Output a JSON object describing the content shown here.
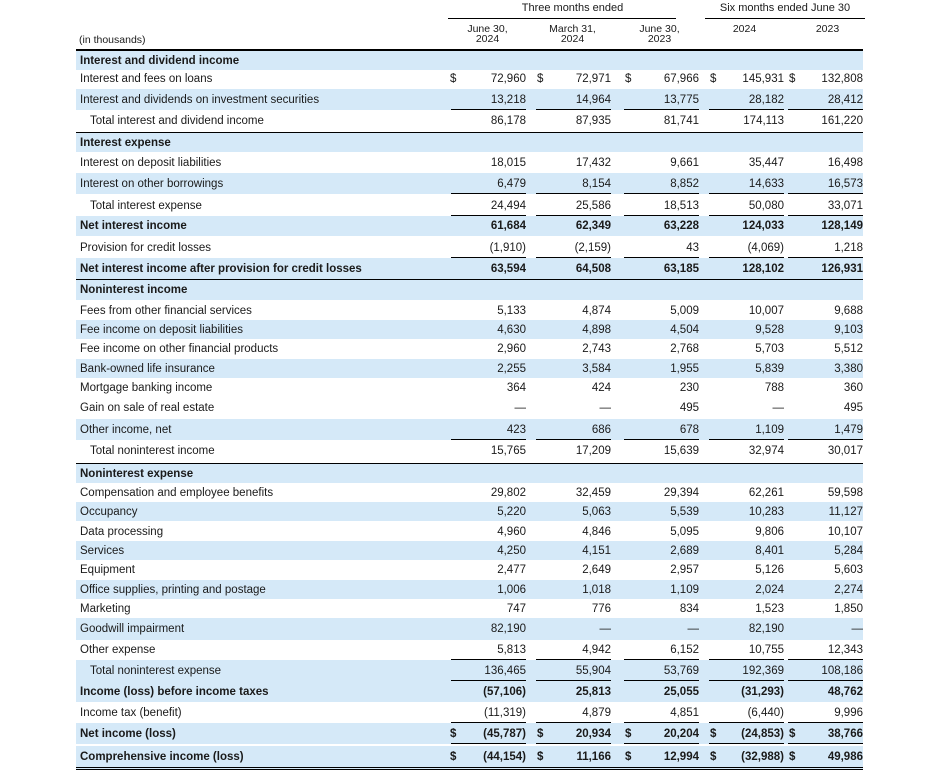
{
  "header": {
    "group_three": "Three months ended",
    "group_six": "Six months ended June 30",
    "units": "(in thousands)",
    "columns": [
      {
        "line1": "June 30,",
        "line2": "2024"
      },
      {
        "line1": "March 31,",
        "line2": "2024"
      },
      {
        "line1": "June 30,",
        "line2": "2023"
      },
      {
        "line1": "",
        "line2": "2024"
      },
      {
        "line1": "",
        "line2": "2023"
      }
    ]
  },
  "rows": [
    {
      "label": "Interest and dividend income",
      "style": "section"
    },
    {
      "label": "Interest and fees on loans",
      "values": [
        "72,960",
        "72,971",
        "67,966",
        "145,931",
        "132,808"
      ],
      "currency": true
    },
    {
      "label": "Interest and dividends on investment securities",
      "values": [
        "13,218",
        "14,964",
        "13,775",
        "28,182",
        "28,412"
      ]
    },
    {
      "label": "Total interest and dividend income",
      "values": [
        "86,178",
        "87,935",
        "81,741",
        "174,113",
        "161,220"
      ],
      "style": "total"
    },
    {
      "label": "Interest expense",
      "style": "section"
    },
    {
      "label": "Interest on deposit liabilities",
      "values": [
        "18,015",
        "17,432",
        "9,661",
        "35,447",
        "16,498"
      ]
    },
    {
      "label": "Interest on other borrowings",
      "values": [
        "6,479",
        "8,154",
        "8,852",
        "14,633",
        "16,573"
      ]
    },
    {
      "label": "Total interest expense",
      "values": [
        "24,494",
        "25,586",
        "18,513",
        "50,080",
        "33,071"
      ],
      "style": "total"
    },
    {
      "label": "Net interest income",
      "values": [
        "61,684",
        "62,349",
        "63,228",
        "124,033",
        "128,149"
      ],
      "style": "bold"
    },
    {
      "label": "Provision for credit losses",
      "values": [
        "(1,910)",
        "(2,159)",
        "43",
        "(4,069)",
        "1,218"
      ]
    },
    {
      "label": "Net interest income after provision for credit losses",
      "values": [
        "63,594",
        "64,508",
        "63,185",
        "128,102",
        "126,931"
      ],
      "style": "bold"
    },
    {
      "label": "Noninterest income",
      "style": "section"
    },
    {
      "label": "Fees from other financial services",
      "values": [
        "5,133",
        "4,874",
        "5,009",
        "10,007",
        "9,688"
      ]
    },
    {
      "label": "Fee income on deposit liabilities",
      "values": [
        "4,630",
        "4,898",
        "4,504",
        "9,528",
        "9,103"
      ]
    },
    {
      "label": "Fee income on other financial products",
      "values": [
        "2,960",
        "2,743",
        "2,768",
        "5,703",
        "5,512"
      ]
    },
    {
      "label": "Bank-owned life insurance",
      "values": [
        "2,255",
        "3,584",
        "1,955",
        "5,839",
        "3,380"
      ]
    },
    {
      "label": "Mortgage banking income",
      "values": [
        "364",
        "424",
        "230",
        "788",
        "360"
      ]
    },
    {
      "label": "Gain on sale of real estate",
      "values": [
        "—",
        "—",
        "495",
        "—",
        "495"
      ]
    },
    {
      "label": "Other income, net",
      "values": [
        "423",
        "686",
        "678",
        "1,109",
        "1,479"
      ]
    },
    {
      "label": "Total noninterest income",
      "values": [
        "15,765",
        "17,209",
        "15,639",
        "32,974",
        "30,017"
      ],
      "style": "total"
    },
    {
      "label": "Noninterest expense",
      "style": "section"
    },
    {
      "label": "Compensation and employee benefits",
      "values": [
        "29,802",
        "32,459",
        "29,394",
        "62,261",
        "59,598"
      ]
    },
    {
      "label": "Occupancy",
      "values": [
        "5,220",
        "5,063",
        "5,539",
        "10,283",
        "11,127"
      ]
    },
    {
      "label": "Data processing",
      "values": [
        "4,960",
        "4,846",
        "5,095",
        "9,806",
        "10,107"
      ]
    },
    {
      "label": "Services",
      "values": [
        "4,250",
        "4,151",
        "2,689",
        "8,401",
        "5,284"
      ]
    },
    {
      "label": "Equipment",
      "values": [
        "2,477",
        "2,649",
        "2,957",
        "5,126",
        "5,603"
      ]
    },
    {
      "label": "Office supplies, printing and postage",
      "values": [
        "1,006",
        "1,018",
        "1,109",
        "2,024",
        "2,274"
      ]
    },
    {
      "label": "Marketing",
      "values": [
        "747",
        "776",
        "834",
        "1,523",
        "1,850"
      ]
    },
    {
      "label": "Goodwill impairment",
      "values": [
        "82,190",
        "—",
        "—",
        "82,190",
        "—"
      ]
    },
    {
      "label": "Other expense",
      "values": [
        "5,813",
        "4,942",
        "6,152",
        "10,755",
        "12,343"
      ]
    },
    {
      "label": "Total noninterest expense",
      "values": [
        "136,465",
        "55,904",
        "53,769",
        "192,369",
        "108,186"
      ],
      "style": "total"
    },
    {
      "label": "Income (loss) before income taxes",
      "values": [
        "(57,106)",
        "25,813",
        "25,055",
        "(31,293)",
        "48,762"
      ],
      "style": "bold"
    },
    {
      "label": "Income tax (benefit)",
      "values": [
        "(11,319)",
        "4,879",
        "4,851",
        "(6,440)",
        "9,996"
      ]
    },
    {
      "label": "Net income (loss)",
      "values": [
        "(45,787)",
        "20,934",
        "20,204",
        "(24,853)",
        "38,766"
      ],
      "style": "bold",
      "currency": true
    },
    {
      "label": "Comprehensive income (loss)",
      "values": [
        "(44,154)",
        "11,166",
        "12,994",
        "(32,988)",
        "49,986"
      ],
      "style": "bold",
      "currency": true
    }
  ],
  "currency_symbol": "$"
}
